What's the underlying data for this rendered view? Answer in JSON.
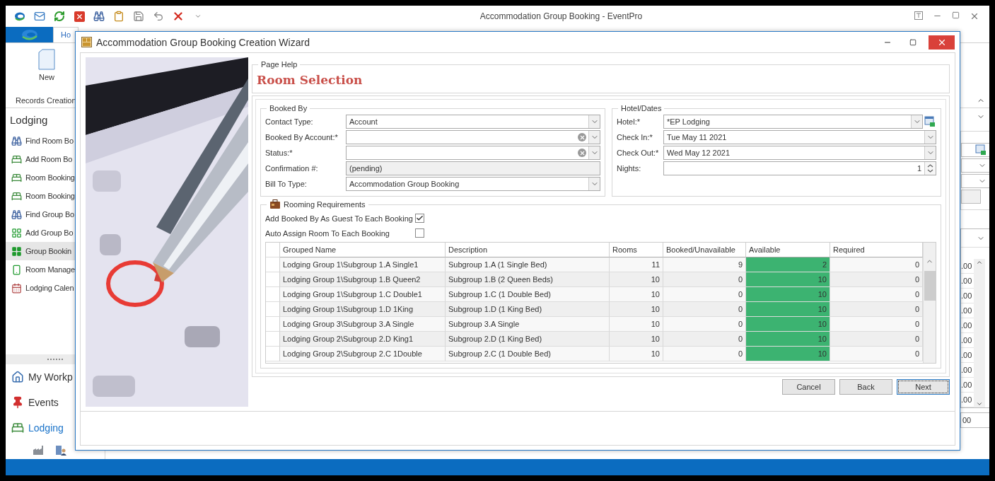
{
  "window": {
    "title": "Accommodation Group Booking - EventPro"
  },
  "ribbon": {
    "tabs": [
      {
        "label": "Ho",
        "selected": true
      }
    ],
    "new_button": "New",
    "group_label": "Records Creation"
  },
  "sidebar": {
    "title": "Lodging",
    "items": [
      {
        "label": "Find Room Bo",
        "selected": false
      },
      {
        "label": "Add Room Bo",
        "selected": false
      },
      {
        "label": "Room Booking",
        "selected": false
      },
      {
        "label": "Room Booking",
        "selected": false
      },
      {
        "label": "Find Group Bo",
        "selected": false
      },
      {
        "label": "Add Group Bo",
        "selected": false
      },
      {
        "label": "Group Bookin",
        "selected": true
      },
      {
        "label": "Room Manage",
        "selected": false
      },
      {
        "label": "Lodging Calen",
        "selected": false
      }
    ],
    "nav": [
      {
        "label": "My Workp",
        "selected": false
      },
      {
        "label": "Events",
        "selected": false
      },
      {
        "label": "Lodging",
        "selected": true
      }
    ]
  },
  "background_grid": {
    "cells": [
      ".00",
      ".00",
      ".00",
      ".00",
      ".00",
      ".00",
      ".00",
      ".00",
      ".00",
      ".00"
    ],
    "total": "00"
  },
  "dialog": {
    "title": "Accommodation Group Booking Creation Wizard",
    "page_help": {
      "legend": "Page Help",
      "heading": "Room Selection"
    },
    "booked_by": {
      "legend": "Booked By",
      "fields": [
        {
          "label": "Contact Type:",
          "value": "Account",
          "kind": "dropdown"
        },
        {
          "label": "Booked By Account:*",
          "kind": "clearable"
        },
        {
          "label": "Status:*",
          "kind": "clearable"
        },
        {
          "label": "Confirmation #:",
          "value": "(pending)",
          "kind": "readonly"
        },
        {
          "label": "Bill To Type:",
          "value": "Accommodation Group Booking",
          "kind": "dropdown"
        }
      ]
    },
    "hotel_dates": {
      "legend": "Hotel/Dates",
      "fields": [
        {
          "label": "Hotel:*",
          "value": "*EP Lodging",
          "kind": "lookup"
        },
        {
          "label": "Check In:*",
          "value": "Tue May 11 2021",
          "kind": "dropdown"
        },
        {
          "label": "Check Out:*",
          "value": "Wed May 12 2021",
          "kind": "dropdown"
        },
        {
          "label": "Nights:",
          "value": "1",
          "kind": "spin"
        }
      ]
    },
    "rooming": {
      "legend": "Rooming Requirements",
      "options": [
        {
          "label": "Add Booked By As Guest To Each Booking",
          "checked": true
        },
        {
          "label": "Auto Assign Room To Each Booking",
          "checked": false
        }
      ],
      "table": {
        "columns": [
          "Grouped Name",
          "Description",
          "Rooms",
          "Booked/Unavailable",
          "Available",
          "Required"
        ],
        "rows": [
          {
            "cells": [
              "Lodging Group 1\\Subgroup 1.A Single1",
              "Subgroup 1.A (1 Single Bed)",
              "11",
              "9",
              "2",
              "0"
            ]
          },
          {
            "cells": [
              "Lodging Group 1\\Subgroup 1.B Queen2",
              "Subgroup 1.B (2 Queen Beds)",
              "10",
              "0",
              "10",
              "0"
            ]
          },
          {
            "cells": [
              "Lodging Group 1\\Subgroup 1.C Double1",
              "Subgroup 1.C (1 Double Bed)",
              "10",
              "0",
              "10",
              "0"
            ]
          },
          {
            "cells": [
              "Lodging Group 1\\Subgroup 1.D 1King",
              "Subgroup 1.D (1 King Bed)",
              "10",
              "0",
              "10",
              "0"
            ]
          },
          {
            "cells": [
              "Lodging Group 3\\Subgroup 3.A Single",
              "Subgroup 3.A Single",
              "10",
              "0",
              "10",
              "0"
            ]
          },
          {
            "cells": [
              "Lodging Group 2\\Subgroup 2.D King1",
              "Subgroup 2.D (1 King Bed)",
              "10",
              "0",
              "10",
              "0"
            ]
          },
          {
            "cells": [
              "Lodging Group 2\\Subgroup 2.C 1Double",
              "Subgroup 2.C (1 Double Bed)",
              "10",
              "0",
              "10",
              "0"
            ]
          }
        ]
      }
    },
    "buttons": [
      {
        "label": "Cancel",
        "focused": false
      },
      {
        "label": "Back",
        "focused": false
      },
      {
        "label": "Next",
        "focused": true
      }
    ]
  }
}
